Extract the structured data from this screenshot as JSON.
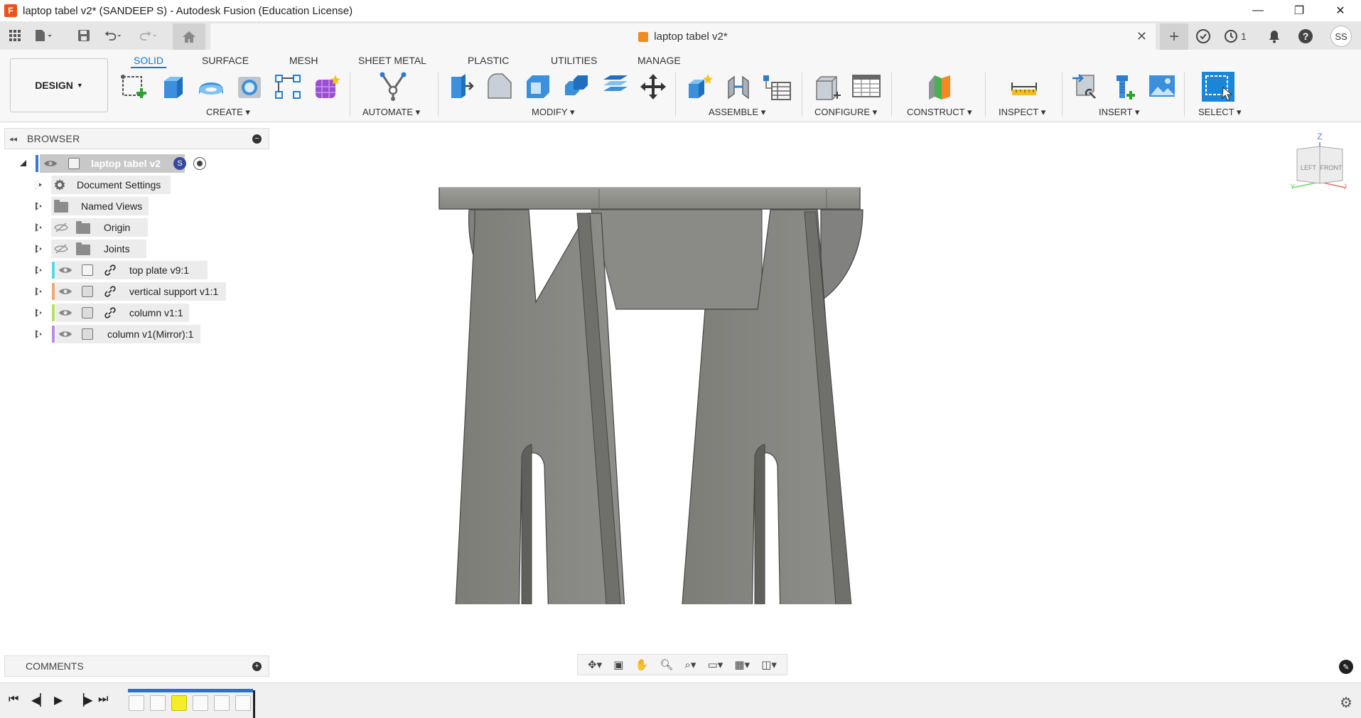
{
  "window": {
    "title": "laptop tabel v2* (SANDEEP S) - Autodesk Fusion (Education License)",
    "logo_letter": "F",
    "minimize": "—",
    "restore": "❐",
    "close": "✕"
  },
  "doc_tab": {
    "title": "laptop tabel v2*",
    "close": "✕",
    "new_tab": "+"
  },
  "top_right": {
    "jobs_count": "1",
    "user_initials": "SS"
  },
  "design_button": "DESIGN",
  "tabs": [
    "SOLID",
    "SURFACE",
    "MESH",
    "SHEET METAL",
    "PLASTIC",
    "UTILITIES",
    "MANAGE"
  ],
  "groups": [
    "CREATE",
    "AUTOMATE",
    "MODIFY",
    "ASSEMBLE",
    "CONFIGURE",
    "CONSTRUCT",
    "INSPECT",
    "INSERT",
    "SELECT"
  ],
  "browser": {
    "title": "BROWSER",
    "root": "laptop tabel v2",
    "items": [
      {
        "label": "Document Settings"
      },
      {
        "label": "Named Views"
      },
      {
        "label": "Origin"
      },
      {
        "label": "Joints"
      },
      {
        "label": "top plate v9:1",
        "color": "#5fd2e2"
      },
      {
        "label": "vertical support v1:1",
        "color": "#f3a66a"
      },
      {
        "label": "column v1:1",
        "color": "#b7df6d"
      },
      {
        "label": "column v1(Mirror):1",
        "color": "#b98be6"
      }
    ]
  },
  "comments": {
    "title": "COMMENTS"
  },
  "viewcube": {
    "axis_z": "Z",
    "axis_x": "X",
    "axis_y": "Y",
    "face_left": "LEFT",
    "face_front": "FRONT"
  },
  "colors": {
    "accent": "#0b7ad0",
    "model_fill": "#8a8a86",
    "timeline_track": "#2d6fd6"
  }
}
